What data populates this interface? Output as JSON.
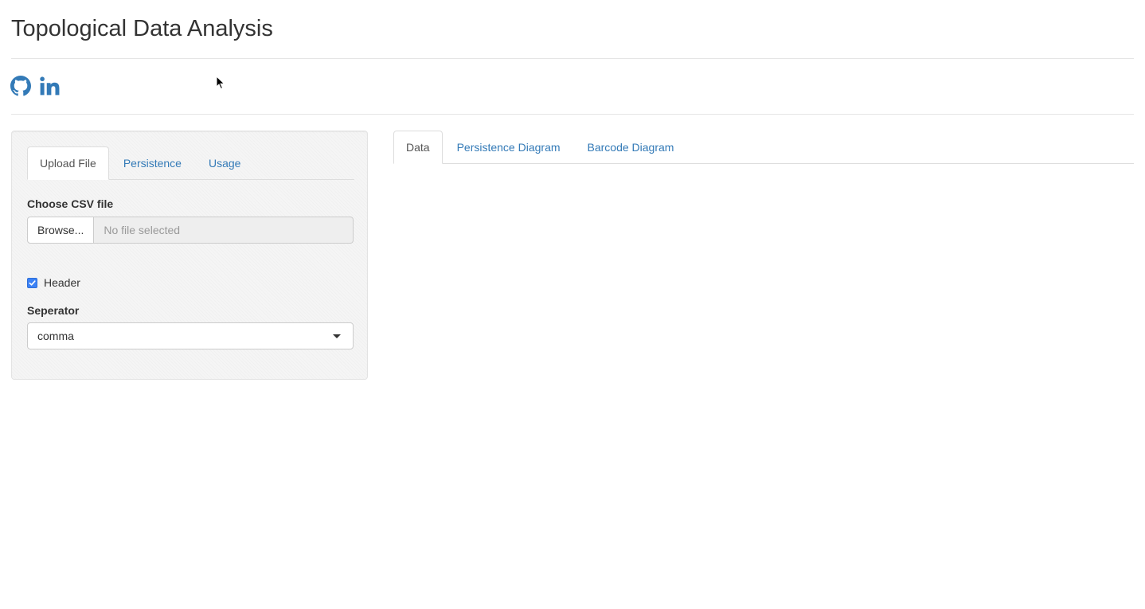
{
  "app": {
    "title": "Topological Data Analysis"
  },
  "social": {
    "github_icon": "github-icon",
    "linkedin_icon": "linkedin-icon"
  },
  "sidebar": {
    "tabs": [
      {
        "label": "Upload File",
        "active": true
      },
      {
        "label": "Persistence",
        "active": false
      },
      {
        "label": "Usage",
        "active": false
      }
    ],
    "file_label": "Choose CSV file",
    "browse_label": "Browse...",
    "file_placeholder": "No file selected",
    "header_checkbox_label": "Header",
    "header_checked": true,
    "separator_label": "Seperator",
    "separator_value": "comma"
  },
  "main": {
    "tabs": [
      {
        "label": "Data",
        "active": true
      },
      {
        "label": "Persistence Diagram",
        "active": false
      },
      {
        "label": "Barcode Diagram",
        "active": false
      }
    ]
  },
  "colors": {
    "link": "#337ab7",
    "text": "#333333",
    "checkbox": "#3b82f6"
  }
}
